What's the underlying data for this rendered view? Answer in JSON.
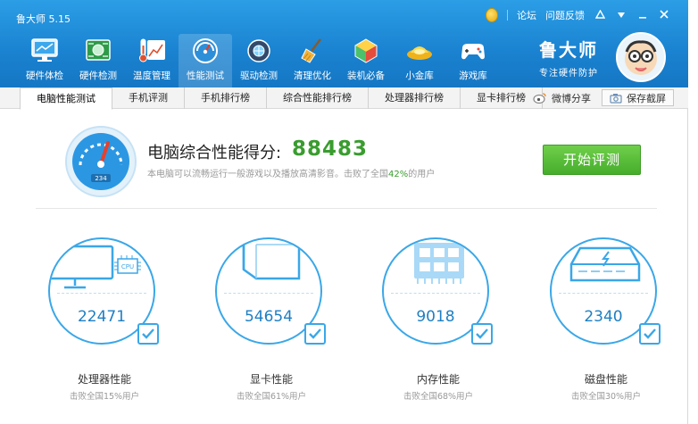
{
  "app": {
    "title": "鲁大师 5.15"
  },
  "topbar": {
    "forum": "论坛",
    "feedback": "问题反馈"
  },
  "nav": [
    {
      "label": "硬件体检",
      "icon": "monitor-icon"
    },
    {
      "label": "硬件检测",
      "icon": "circuit-board-icon"
    },
    {
      "label": "温度管理",
      "icon": "thermometer-chart-icon"
    },
    {
      "label": "性能测试",
      "icon": "speedometer-icon",
      "active": true
    },
    {
      "label": "驱动检测",
      "icon": "gear-shield-icon"
    },
    {
      "label": "清理优化",
      "icon": "broom-icon"
    },
    {
      "label": "装机必备",
      "icon": "cube-icon"
    },
    {
      "label": "小金库",
      "icon": "gold-ingot-icon"
    },
    {
      "label": "游戏库",
      "icon": "gamepad-icon"
    }
  ],
  "brand": {
    "name": "鲁大师",
    "subtitle": "专注硬件防护"
  },
  "subtabs": [
    {
      "label": "电脑性能测试",
      "active": true
    },
    {
      "label": "手机评测"
    },
    {
      "label": "手机排行榜"
    },
    {
      "label": "综合性能排行榜"
    },
    {
      "label": "处理器排行榜"
    },
    {
      "label": "显卡排行榜"
    }
  ],
  "actions": {
    "share": "微博分享",
    "save": "保存截屏"
  },
  "score": {
    "label": "电脑综合性能得分:",
    "value": "88483",
    "desc_prefix": "本电脑可以流畅运行一般游戏以及播放高清影音。击败了全国",
    "pct": "42%",
    "desc_suffix": "的用户",
    "gauge_reading": "234"
  },
  "start_button": "开始评测",
  "cards": [
    {
      "title": "处理器性能",
      "value": "22471",
      "sub": "击败全国15%用户",
      "icon": "cpu-monitor-icon",
      "chip_text": "CPU"
    },
    {
      "title": "显卡性能",
      "value": "54654",
      "sub": "击败全国61%用户",
      "icon": "gpu-cube-icon"
    },
    {
      "title": "内存性能",
      "value": "9018",
      "sub": "击败全国68%用户",
      "icon": "memory-chip-icon"
    },
    {
      "title": "磁盘性能",
      "value": "2340",
      "sub": "击败全国30%用户",
      "icon": "disk-drive-icon"
    }
  ],
  "colors": {
    "header": "#1a82d0",
    "accent": "#3aa7e8",
    "score_green": "#3a9c2f",
    "button_green": "#46ad2c"
  }
}
